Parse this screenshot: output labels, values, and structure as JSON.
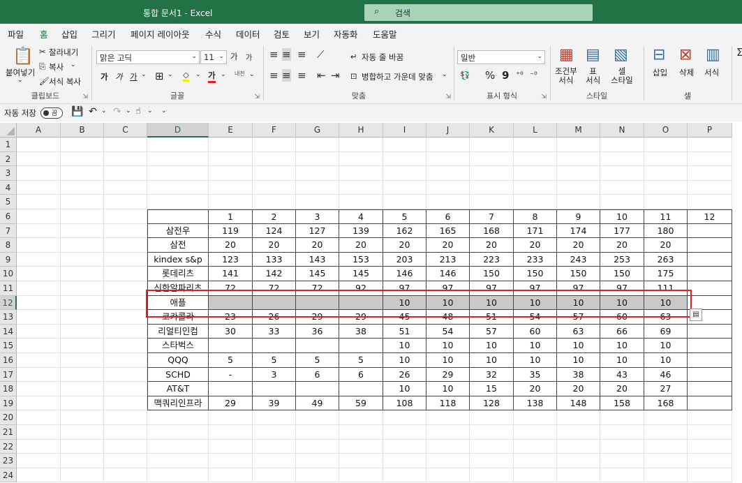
{
  "window": {
    "title": "통합 문서1  -  Excel",
    "search_placeholder": "검색"
  },
  "menu": [
    "파일",
    "홈",
    "삽입",
    "그리기",
    "페이지 레이아웃",
    "수식",
    "데이터",
    "검토",
    "보기",
    "자동화",
    "도움말"
  ],
  "active_menu": "홈",
  "ribbon": {
    "clipboard": {
      "paste": "붙여넣기",
      "cut": "잘라내기",
      "copy": "복사",
      "format_painter": "서식 복사",
      "group": "클립보드"
    },
    "font": {
      "name": "맑은 고딕",
      "size": "11",
      "grow": "가",
      "shrink": "가",
      "bold": "가",
      "italic": "가",
      "underline": "가",
      "color_a": "가",
      "phonetic": "내천",
      "group": "글꼴"
    },
    "alignment": {
      "wrap": "자동 줄 바꿈",
      "merge": "병합하고 가운데 맞춤",
      "group": "맞춤"
    },
    "number": {
      "format": "일반",
      "percent": "%",
      "comma": "9",
      "group": "표시 형식"
    },
    "styles": {
      "conditional": "조건부\n서식",
      "table": "표\n서식",
      "cell": "셀\n스타일",
      "group": "스타일"
    },
    "cells": {
      "insert": "삽입",
      "delete": "삭제",
      "format": "서식",
      "group": "셀"
    }
  },
  "qat": {
    "autosave": "자동 저장",
    "toggle": "끔"
  },
  "columns": [
    "A",
    "B",
    "C",
    "D",
    "E",
    "F",
    "G",
    "H",
    "I",
    "J",
    "K",
    "L",
    "M",
    "N",
    "O",
    "P"
  ],
  "selected_column": "D",
  "rows": [
    "1",
    "2",
    "3",
    "4",
    "5",
    "6",
    "7",
    "8",
    "9",
    "10",
    "11",
    "12",
    "13",
    "14",
    "15",
    "16",
    "17",
    "18",
    "19",
    "20",
    "21",
    "22",
    "23",
    "24"
  ],
  "selected_row": "12",
  "table": {
    "header": [
      "",
      "1",
      "2",
      "3",
      "4",
      "5",
      "6",
      "7",
      "8",
      "9",
      "10",
      "11",
      "12"
    ],
    "rows": [
      [
        "삼전우",
        "119",
        "124",
        "127",
        "139",
        "162",
        "165",
        "168",
        "171",
        "174",
        "177",
        "180",
        ""
      ],
      [
        "삼전",
        "20",
        "20",
        "20",
        "20",
        "20",
        "20",
        "20",
        "20",
        "20",
        "20",
        "20",
        ""
      ],
      [
        "kindex s&p",
        "123",
        "133",
        "143",
        "153",
        "203",
        "213",
        "223",
        "233",
        "243",
        "253",
        "263",
        ""
      ],
      [
        "롯데리츠",
        "141",
        "142",
        "145",
        "145",
        "146",
        "146",
        "150",
        "150",
        "150",
        "150",
        "175",
        ""
      ],
      [
        "신한알파리츠",
        "72",
        "72",
        "72",
        "92",
        "97",
        "97",
        "97",
        "97",
        "97",
        "97",
        "111",
        ""
      ],
      [
        "애플",
        "",
        "",
        "",
        "",
        "10",
        "10",
        "10",
        "10",
        "10",
        "10",
        "10",
        ""
      ],
      [
        "코카콜라",
        "23",
        "26",
        "29",
        "29",
        "45",
        "48",
        "51",
        "54",
        "57",
        "60",
        "63",
        ""
      ],
      [
        "리얼티인컴",
        "30",
        "33",
        "36",
        "38",
        "51",
        "54",
        "57",
        "60",
        "63",
        "66",
        "69",
        ""
      ],
      [
        "스타벅스",
        "",
        "",
        "",
        "",
        "10",
        "10",
        "10",
        "10",
        "10",
        "10",
        "10",
        ""
      ],
      [
        "QQQ",
        "5",
        "5",
        "5",
        "5",
        "10",
        "10",
        "10",
        "10",
        "10",
        "10",
        "10",
        ""
      ],
      [
        "SCHD",
        "-",
        "3",
        "6",
        "6",
        "26",
        "29",
        "32",
        "35",
        "38",
        "43",
        "46",
        ""
      ],
      [
        "AT&T",
        "",
        "",
        "",
        "",
        "10",
        "10",
        "15",
        "20",
        "20",
        "20",
        "27",
        ""
      ],
      [
        "맥쿼리인프라",
        "29",
        "39",
        "49",
        "59",
        "108",
        "118",
        "128",
        "138",
        "148",
        "158",
        "168",
        ""
      ]
    ]
  }
}
